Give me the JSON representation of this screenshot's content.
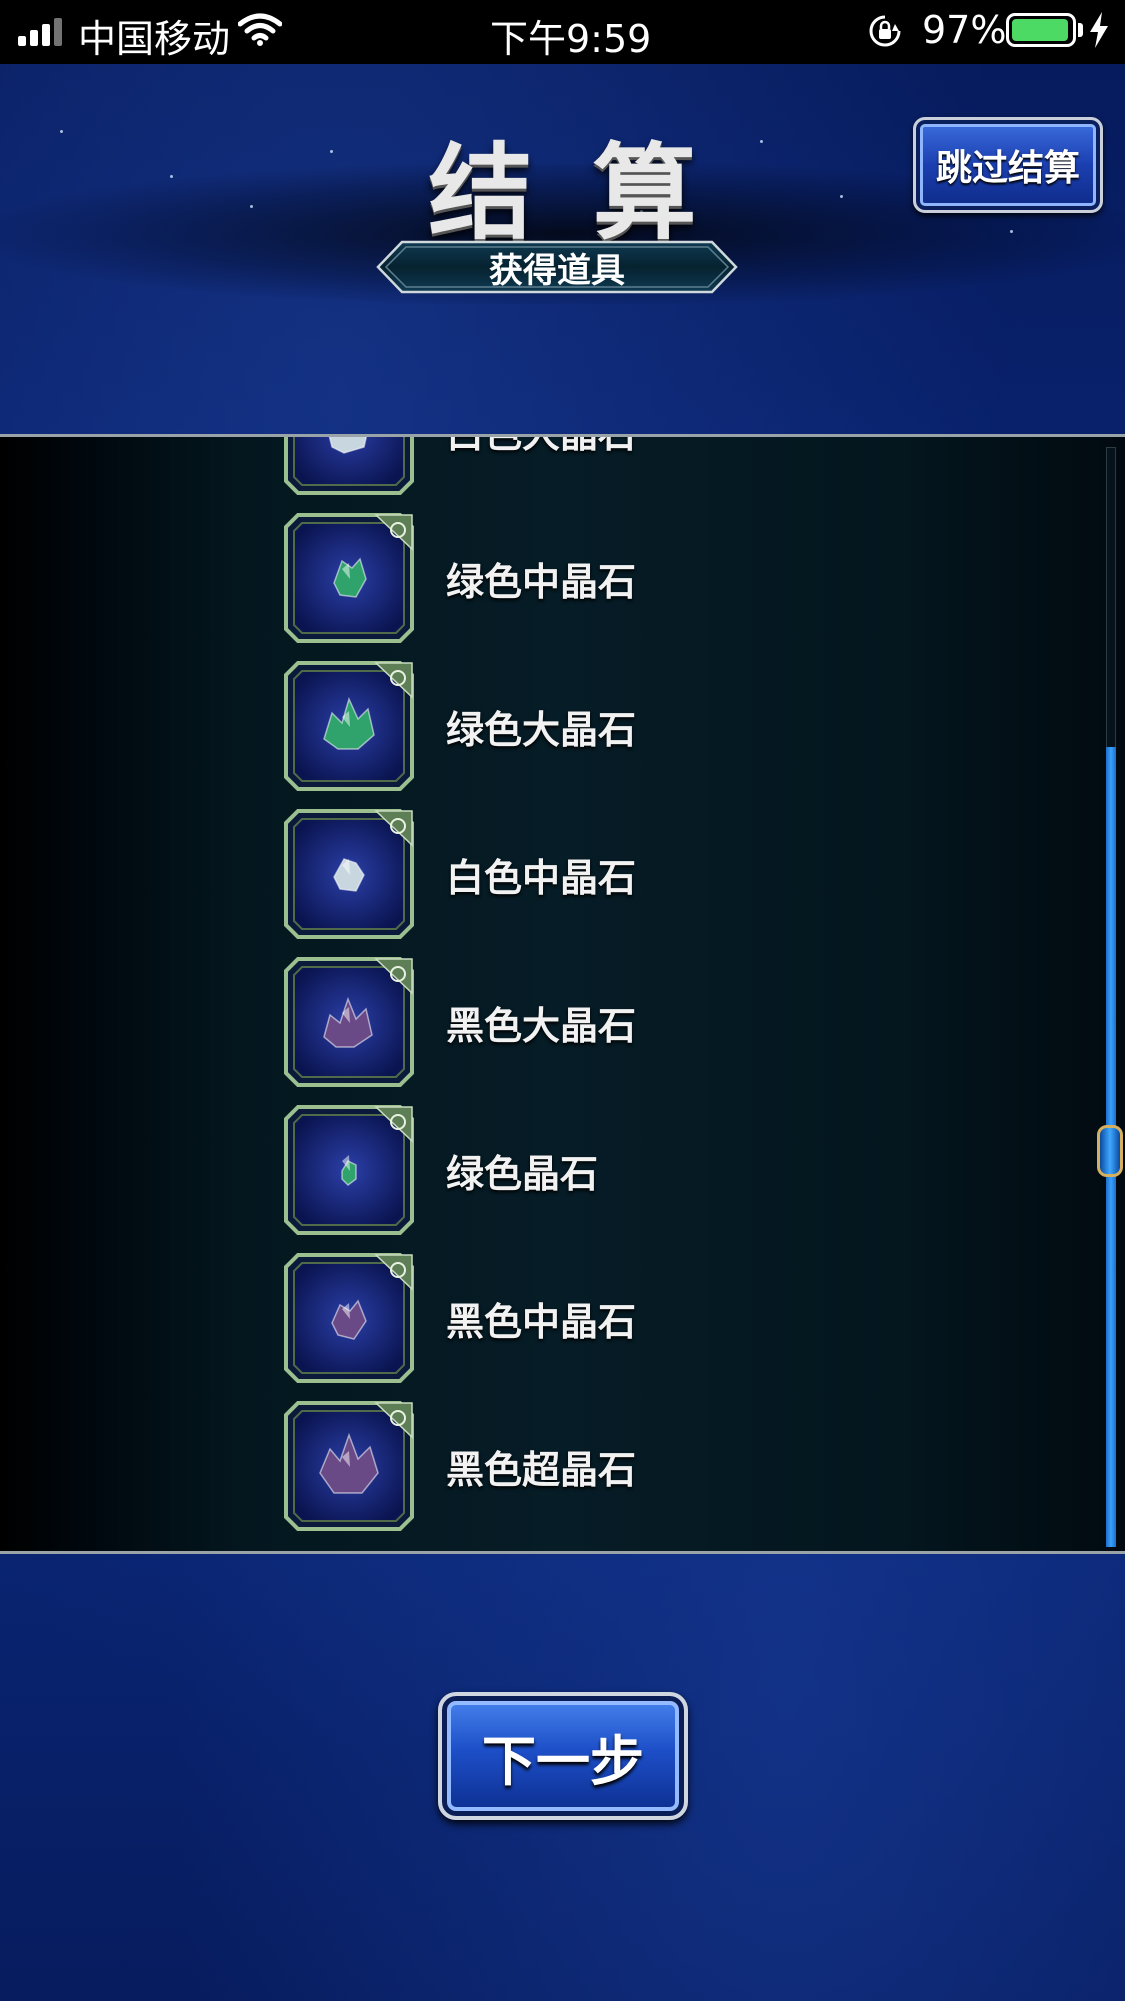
{
  "status_bar": {
    "carrier": "中国移动",
    "time": "下午9:59",
    "battery_percent": "97%",
    "battery_level": 0.97,
    "icons": [
      "signal-icon",
      "wifi-icon",
      "rotation-lock-icon",
      "battery-icon",
      "charging-icon"
    ]
  },
  "header": {
    "title": "结算",
    "skip_button_label": "跳过结算",
    "subtitle": "获得道具"
  },
  "item_list": {
    "items": [
      {
        "name": "白色大晶石",
        "icon": "white-crystal-large-icon",
        "color": "#c8d6e0"
      },
      {
        "name": "绿色中晶石",
        "icon": "green-crystal-medium-icon",
        "color": "#2fa36b"
      },
      {
        "name": "绿色大晶石",
        "icon": "green-crystal-large-icon",
        "color": "#2fa36b"
      },
      {
        "name": "白色中晶石",
        "icon": "white-crystal-medium-icon",
        "color": "#c8d6e0"
      },
      {
        "name": "黑色大晶石",
        "icon": "black-crystal-large-icon",
        "color": "#6a4a86"
      },
      {
        "name": "绿色晶石",
        "icon": "green-crystal-icon",
        "color": "#2fa36b"
      },
      {
        "name": "黑色中晶石",
        "icon": "black-crystal-medium-icon",
        "color": "#6a4a86"
      },
      {
        "name": "黑色超晶石",
        "icon": "black-crystal-super-icon",
        "color": "#6a4a86"
      }
    ]
  },
  "footer": {
    "next_button_label": "下一步"
  },
  "colors": {
    "background_blue": "#0a2472",
    "panel_dark": "#061c26",
    "frame_green": "#7fa27a",
    "accent_blue": "#3aa0ff",
    "thumb_gold": "#d4b060"
  }
}
